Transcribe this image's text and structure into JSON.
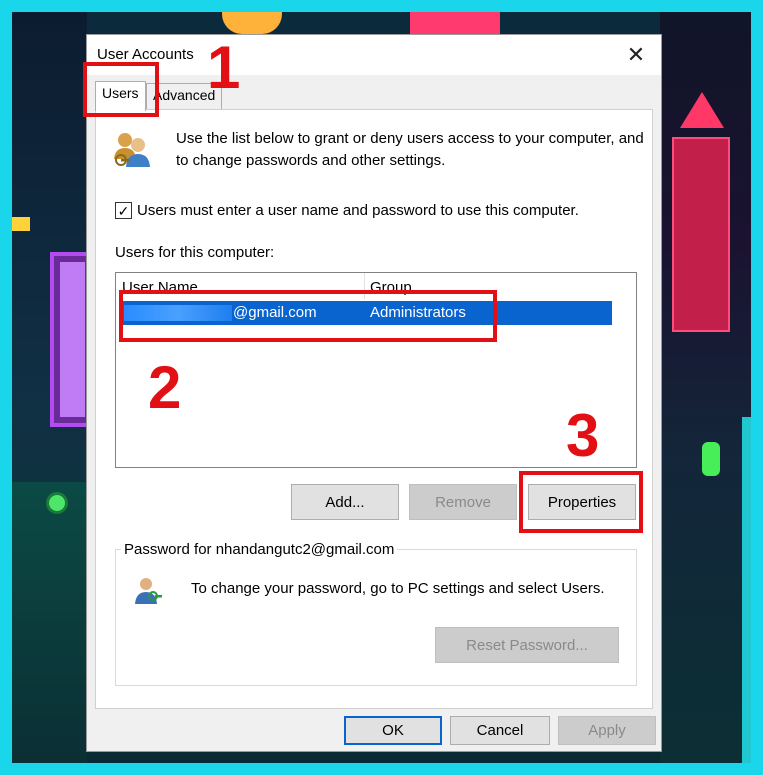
{
  "window": {
    "title": "User Accounts",
    "close_glyph": "✕"
  },
  "tabs": [
    {
      "label": "Users",
      "active": true
    },
    {
      "label": "Advanced",
      "active": false
    }
  ],
  "users_tab": {
    "intro_icon": "users-group-icon",
    "intro_text": "Use the list below to grant or deny users access to your computer, and to change passwords and other settings.",
    "require_login": {
      "checked": true,
      "label": "Users must enter a user name and password to use this computer."
    },
    "users_label": "Users for this computer:",
    "table": {
      "columns": [
        "User Name",
        "Group"
      ],
      "rows": [
        {
          "user_suffix": "@gmail.com",
          "group": "Administrators",
          "selected": true
        }
      ]
    },
    "buttons": {
      "add": "Add...",
      "remove": "Remove",
      "properties": "Properties"
    },
    "password_group": {
      "legend": "Password for nhandangutc2@gmail.com",
      "icon": "user-key-icon",
      "text": "To change your password, go to PC settings and select Users.",
      "reset_button": "Reset Password..."
    }
  },
  "footer": {
    "ok": "OK",
    "cancel": "Cancel",
    "apply": "Apply"
  },
  "annotations": {
    "step1": "1",
    "step2": "2",
    "step3": "3",
    "color": "#e20f14"
  }
}
